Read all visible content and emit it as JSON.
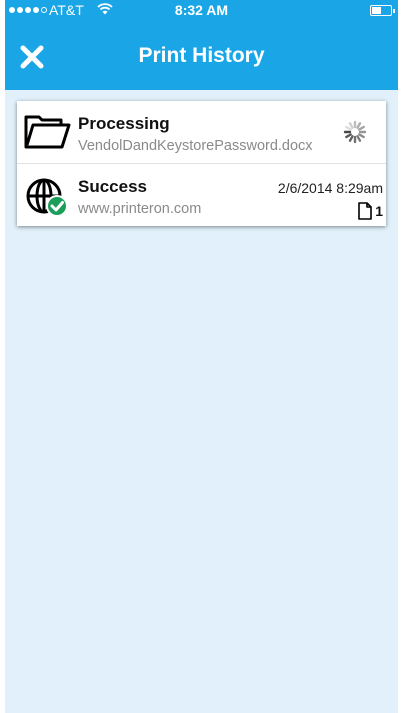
{
  "status_bar": {
    "carrier": "AT&T",
    "time": "8:32 AM"
  },
  "navbar": {
    "title": "Print History",
    "close_icon": "close-icon"
  },
  "jobs": [
    {
      "status": "Processing",
      "name": "VendolDandKeystorePassword.docx",
      "icon": "folder-icon",
      "indicator": "spinner-icon"
    },
    {
      "status": "Success",
      "name": "www.printeron.com",
      "icon": "globe-check-icon",
      "date": "2/6/2014 8:29am",
      "pages": "1",
      "page_icon": "page-icon"
    }
  ],
  "colors": {
    "header": "#1aa6e6",
    "background": "#e1f0fa",
    "success_badge": "#1a9e5a"
  }
}
